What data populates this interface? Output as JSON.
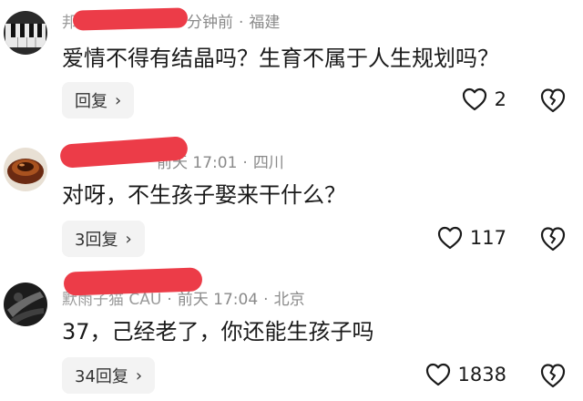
{
  "comments": [
    {
      "author": "邦",
      "time": "分钟前",
      "location": "福建",
      "text": "爱情不得有结晶吗？生育不属于人生规划吗？",
      "reply_label": "回复",
      "likes": "2"
    },
    {
      "author": "",
      "time": "前天 17:01",
      "location": "四川",
      "text": "对呀，不生孩子娶来干什么？",
      "reply_label": "3回复",
      "likes": "117"
    },
    {
      "author": "默雨子猫 CAU",
      "time": "前天 17:04",
      "location": "北京",
      "text": "37，己经老了，你还能生孩子吗",
      "reply_label": "34回复",
      "likes": "1838"
    }
  ],
  "colors": {
    "redaction": "#ec3c48",
    "meta": "#8a8a8a"
  },
  "icons": [
    "heart-outline-icon",
    "broken-heart-icon",
    "chevron-right-icon"
  ]
}
